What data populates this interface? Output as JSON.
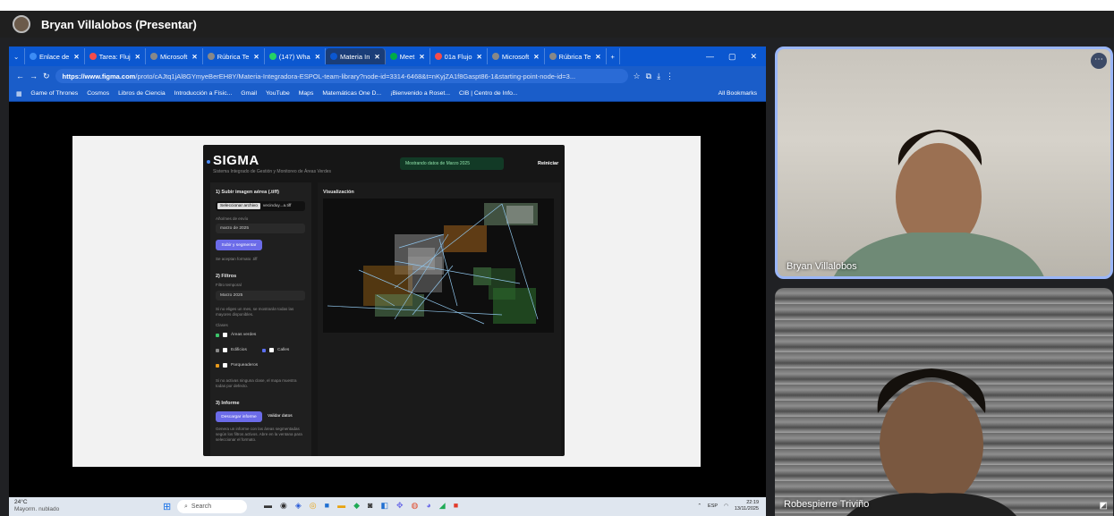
{
  "meet": {
    "title": "Bryan Villalobos (Presentar)"
  },
  "browser": {
    "tabs": [
      {
        "label": "Enlace de",
        "color": "#3c8cf5"
      },
      {
        "label": "Tarea: Fluj",
        "color": "#f54c4c"
      },
      {
        "label": "Microsoft",
        "color": "#888888"
      },
      {
        "label": "Rúbrica Te",
        "color": "#888888"
      },
      {
        "label": "(147) Wha",
        "color": "#25d366"
      },
      {
        "label": "Materia In",
        "color": "#0b57d0",
        "active": true
      },
      {
        "label": "Meet",
        "color": "#00ac47"
      },
      {
        "label": "01a Flujo",
        "color": "#f54c4c"
      },
      {
        "label": "Microsoft",
        "color": "#888888"
      },
      {
        "label": "Rúbrica Te",
        "color": "#888888"
      }
    ],
    "url_domain": "https://www.figma.com",
    "url_path": "/proto/cAJtq1jAl8GYmyeBerEH8Y/Materia-Integradora-ESPOL-team-library?node-id=3314-6468&t=nKyjZA1f8Gaspt86-1&starting-point-node-id=3...",
    "bookmarks": [
      "Game of Thrones",
      "Cosmos",
      "Libros de Ciencia",
      "Introducción a Físic...",
      "Gmail",
      "YouTube",
      "Maps",
      "Matemáticas One D...",
      "¡Bienvenido a Roset...",
      "CIB | Centro de Info..."
    ],
    "all_bookmarks": "All Bookmarks"
  },
  "app": {
    "logo": "SIGMA",
    "subtitle": "Sistema Integrado de Gestión y Monitoreo de Áreas Verdes",
    "banner": "Mostrando datos de Marzo 2025",
    "reset": "Reiniciar",
    "s1": {
      "title": "1) Subir imagen aérea (.tiff)",
      "choose": "Seleccionar archivo",
      "file": "vecinduy...a.tiff",
      "date_label": "Año/mes de envío",
      "date": "marzo de 2025",
      "upload": "Subir y segmentar",
      "hint": "Se aceptan formato .tiff"
    },
    "s2": {
      "title": "2) Filtros",
      "filter_label": "Filtro temporal",
      "month": "Marzo 2025",
      "note": "Si no eliges un mes, se mostrarán todas las mayores disponibles.",
      "classes": "Clases",
      "c1": "Áreas verdes",
      "c2": "Edificios",
      "c3": "Calles",
      "c4": "Parqueaderos",
      "note2": "Si no activas ninguna clase, el mapa muestra todas por defecto."
    },
    "s3": {
      "title": "3) Informe",
      "download": "Descargar informe",
      "validate": "Validar datos",
      "note": "Genera un informe con las áreas segmentadas según los filtros activos. Abre en la ventana para seleccionar el formato."
    },
    "viz_title": "Visualización"
  },
  "speakers": [
    {
      "name": "Bryan Villalobos"
    },
    {
      "name": "Robespierre Triviño"
    }
  ],
  "taskbar": {
    "weather_temp": "24°C",
    "weather_desc": "Mayorm. nublado",
    "search": "Search",
    "lang": "ESP",
    "time": "22:19",
    "date": "13/11/2025"
  }
}
